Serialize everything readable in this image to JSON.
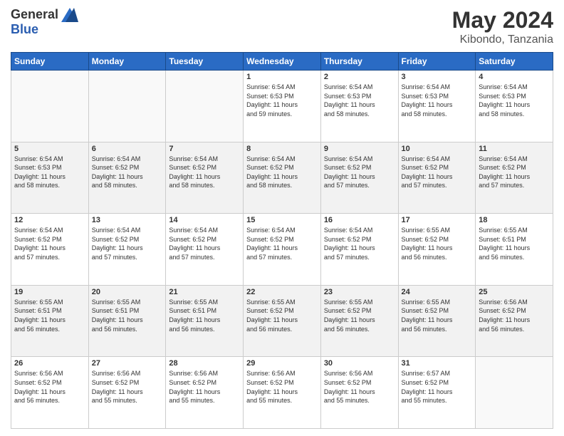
{
  "header": {
    "logo": {
      "general": "General",
      "blue": "Blue"
    },
    "title": "May 2024",
    "location": "Kibondo, Tanzania"
  },
  "weekdays": [
    "Sunday",
    "Monday",
    "Tuesday",
    "Wednesday",
    "Thursday",
    "Friday",
    "Saturday"
  ],
  "weeks": [
    [
      {
        "day": "",
        "info": ""
      },
      {
        "day": "",
        "info": ""
      },
      {
        "day": "",
        "info": ""
      },
      {
        "day": "1",
        "info": "Sunrise: 6:54 AM\nSunset: 6:53 PM\nDaylight: 11 hours\nand 59 minutes."
      },
      {
        "day": "2",
        "info": "Sunrise: 6:54 AM\nSunset: 6:53 PM\nDaylight: 11 hours\nand 58 minutes."
      },
      {
        "day": "3",
        "info": "Sunrise: 6:54 AM\nSunset: 6:53 PM\nDaylight: 11 hours\nand 58 minutes."
      },
      {
        "day": "4",
        "info": "Sunrise: 6:54 AM\nSunset: 6:53 PM\nDaylight: 11 hours\nand 58 minutes."
      }
    ],
    [
      {
        "day": "5",
        "info": "Sunrise: 6:54 AM\nSunset: 6:53 PM\nDaylight: 11 hours\nand 58 minutes."
      },
      {
        "day": "6",
        "info": "Sunrise: 6:54 AM\nSunset: 6:52 PM\nDaylight: 11 hours\nand 58 minutes."
      },
      {
        "day": "7",
        "info": "Sunrise: 6:54 AM\nSunset: 6:52 PM\nDaylight: 11 hours\nand 58 minutes."
      },
      {
        "day": "8",
        "info": "Sunrise: 6:54 AM\nSunset: 6:52 PM\nDaylight: 11 hours\nand 58 minutes."
      },
      {
        "day": "9",
        "info": "Sunrise: 6:54 AM\nSunset: 6:52 PM\nDaylight: 11 hours\nand 57 minutes."
      },
      {
        "day": "10",
        "info": "Sunrise: 6:54 AM\nSunset: 6:52 PM\nDaylight: 11 hours\nand 57 minutes."
      },
      {
        "day": "11",
        "info": "Sunrise: 6:54 AM\nSunset: 6:52 PM\nDaylight: 11 hours\nand 57 minutes."
      }
    ],
    [
      {
        "day": "12",
        "info": "Sunrise: 6:54 AM\nSunset: 6:52 PM\nDaylight: 11 hours\nand 57 minutes."
      },
      {
        "day": "13",
        "info": "Sunrise: 6:54 AM\nSunset: 6:52 PM\nDaylight: 11 hours\nand 57 minutes."
      },
      {
        "day": "14",
        "info": "Sunrise: 6:54 AM\nSunset: 6:52 PM\nDaylight: 11 hours\nand 57 minutes."
      },
      {
        "day": "15",
        "info": "Sunrise: 6:54 AM\nSunset: 6:52 PM\nDaylight: 11 hours\nand 57 minutes."
      },
      {
        "day": "16",
        "info": "Sunrise: 6:54 AM\nSunset: 6:52 PM\nDaylight: 11 hours\nand 57 minutes."
      },
      {
        "day": "17",
        "info": "Sunrise: 6:55 AM\nSunset: 6:52 PM\nDaylight: 11 hours\nand 56 minutes."
      },
      {
        "day": "18",
        "info": "Sunrise: 6:55 AM\nSunset: 6:51 PM\nDaylight: 11 hours\nand 56 minutes."
      }
    ],
    [
      {
        "day": "19",
        "info": "Sunrise: 6:55 AM\nSunset: 6:51 PM\nDaylight: 11 hours\nand 56 minutes."
      },
      {
        "day": "20",
        "info": "Sunrise: 6:55 AM\nSunset: 6:51 PM\nDaylight: 11 hours\nand 56 minutes."
      },
      {
        "day": "21",
        "info": "Sunrise: 6:55 AM\nSunset: 6:51 PM\nDaylight: 11 hours\nand 56 minutes."
      },
      {
        "day": "22",
        "info": "Sunrise: 6:55 AM\nSunset: 6:52 PM\nDaylight: 11 hours\nand 56 minutes."
      },
      {
        "day": "23",
        "info": "Sunrise: 6:55 AM\nSunset: 6:52 PM\nDaylight: 11 hours\nand 56 minutes."
      },
      {
        "day": "24",
        "info": "Sunrise: 6:55 AM\nSunset: 6:52 PM\nDaylight: 11 hours\nand 56 minutes."
      },
      {
        "day": "25",
        "info": "Sunrise: 6:56 AM\nSunset: 6:52 PM\nDaylight: 11 hours\nand 56 minutes."
      }
    ],
    [
      {
        "day": "26",
        "info": "Sunrise: 6:56 AM\nSunset: 6:52 PM\nDaylight: 11 hours\nand 56 minutes."
      },
      {
        "day": "27",
        "info": "Sunrise: 6:56 AM\nSunset: 6:52 PM\nDaylight: 11 hours\nand 55 minutes."
      },
      {
        "day": "28",
        "info": "Sunrise: 6:56 AM\nSunset: 6:52 PM\nDaylight: 11 hours\nand 55 minutes."
      },
      {
        "day": "29",
        "info": "Sunrise: 6:56 AM\nSunset: 6:52 PM\nDaylight: 11 hours\nand 55 minutes."
      },
      {
        "day": "30",
        "info": "Sunrise: 6:56 AM\nSunset: 6:52 PM\nDaylight: 11 hours\nand 55 minutes."
      },
      {
        "day": "31",
        "info": "Sunrise: 6:57 AM\nSunset: 6:52 PM\nDaylight: 11 hours\nand 55 minutes."
      },
      {
        "day": "",
        "info": ""
      }
    ]
  ]
}
